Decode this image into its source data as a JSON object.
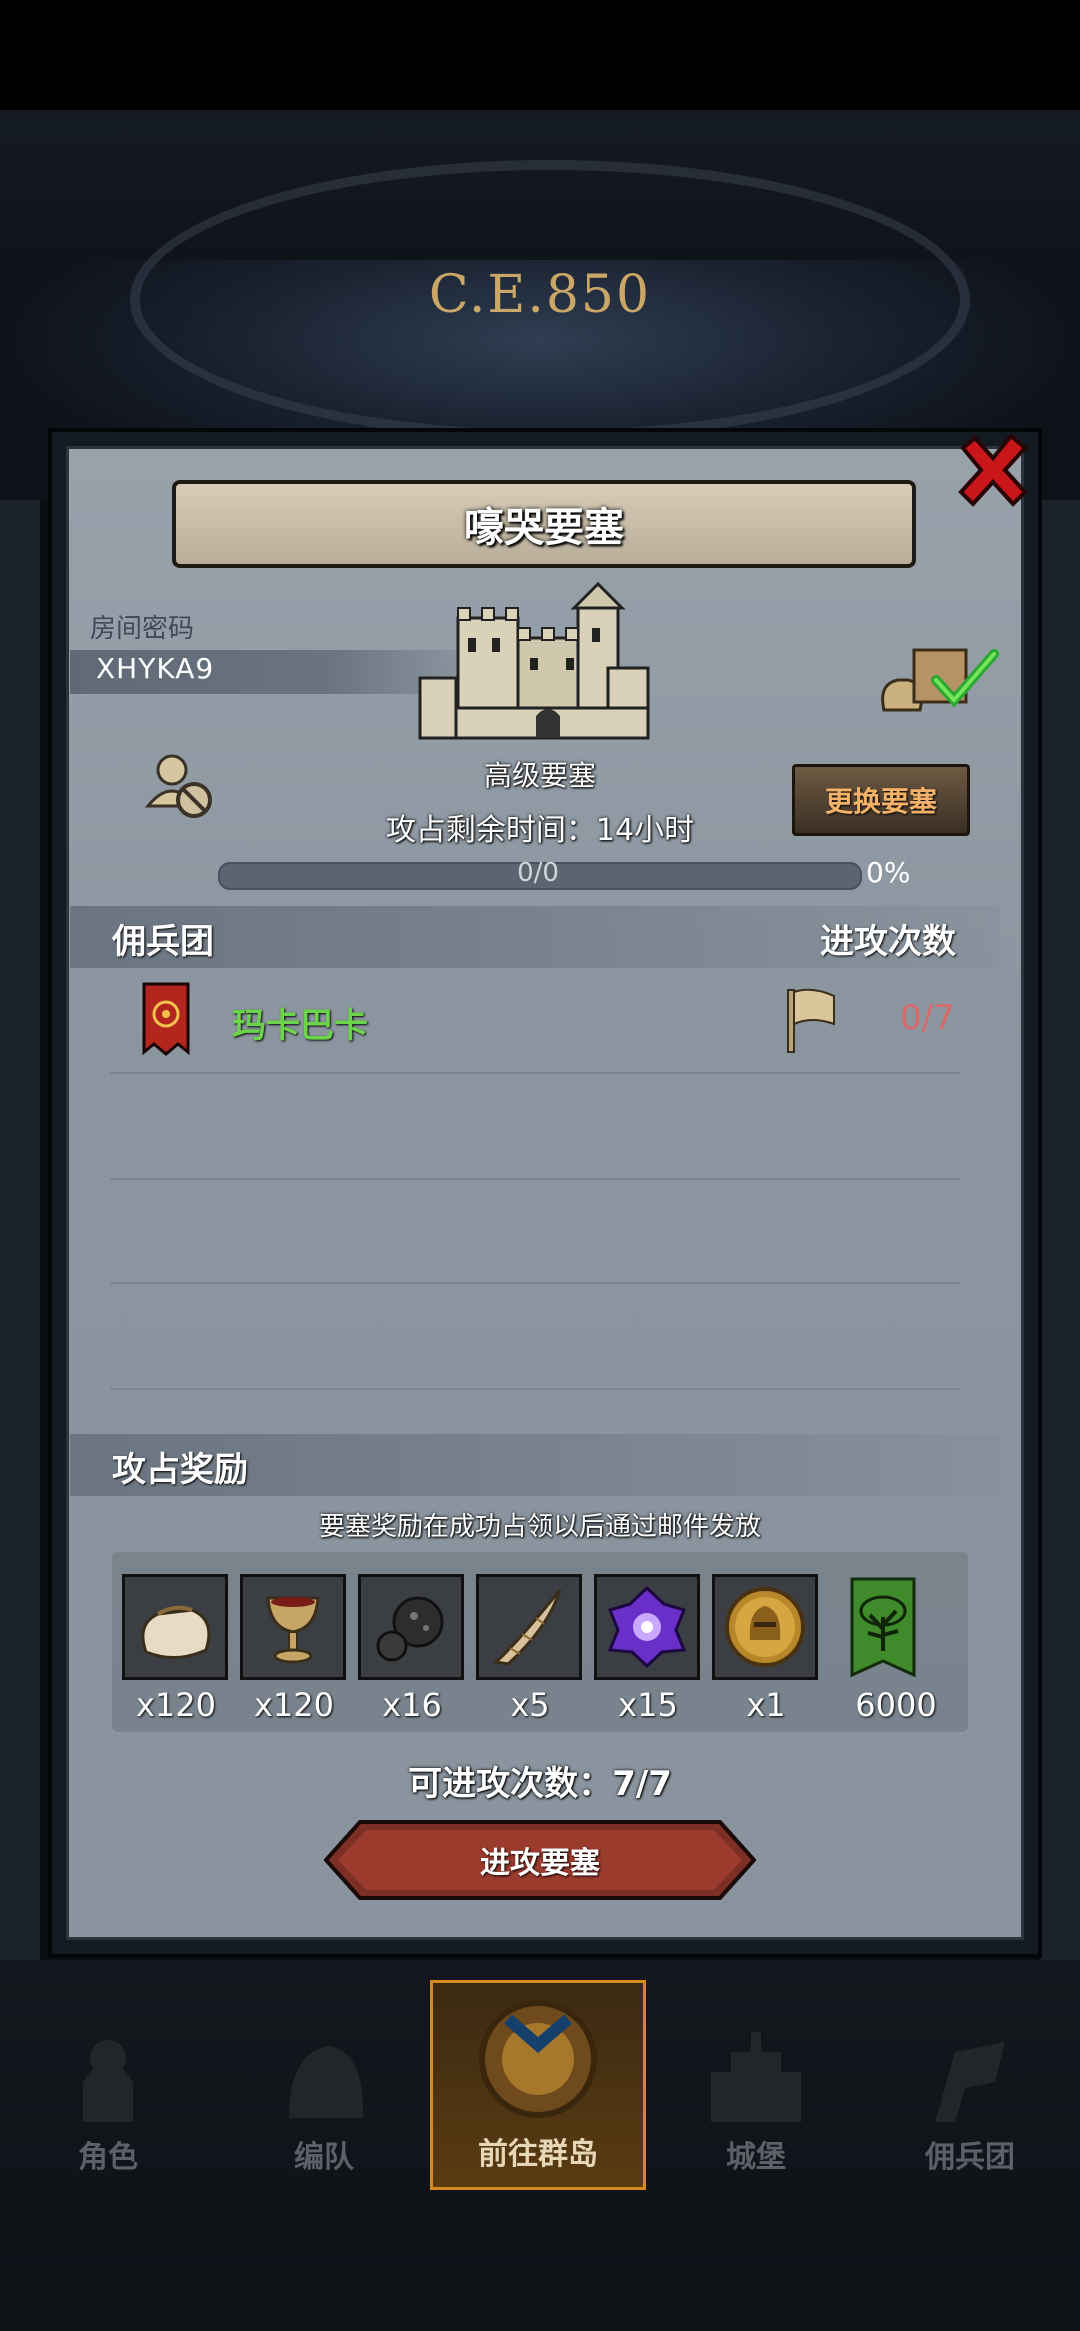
{
  "background": {
    "era_label": "C.E.850"
  },
  "dialog": {
    "title": "嚎哭要塞",
    "room": {
      "label": "房间密码",
      "code": "XHYKA9"
    },
    "fortress_level": "高级要塞",
    "time_left": "攻占剩余时间：14小时",
    "progress": {
      "text": "0/0",
      "percent_label": "0%",
      "fraction": 0
    },
    "change_button": "更换要塞",
    "mercenary_section": {
      "title": "佣兵团",
      "attack_header": "进攻次数",
      "rows": [
        {
          "name": "玛卡巴卡",
          "attacks": "0/7"
        }
      ]
    },
    "rewards": {
      "title": "攻占奖励",
      "note": "要塞奖励在成功占领以后通过邮件发放",
      "items": [
        {
          "icon": "sack-icon",
          "qty": "x120"
        },
        {
          "icon": "goblet-icon",
          "qty": "x120"
        },
        {
          "icon": "ore-icon",
          "qty": "x16"
        },
        {
          "icon": "horn-icon",
          "qty": "x5"
        },
        {
          "icon": "purple-crystal-icon",
          "qty": "x15"
        },
        {
          "icon": "knight-medal-icon",
          "qty": "x1"
        },
        {
          "icon": "tree-banner-icon",
          "qty": "6000"
        }
      ]
    },
    "attempts": "可进攻次数：7/7",
    "attack_button": "进攻要塞"
  },
  "nav": {
    "items": [
      {
        "label": "角色",
        "active": false
      },
      {
        "label": "编队",
        "active": false
      },
      {
        "label": "前往群岛",
        "active": true
      },
      {
        "label": "城堡",
        "active": false
      },
      {
        "label": "佣兵团",
        "active": false
      }
    ]
  },
  "colors": {
    "accent_green": "#6bd44a",
    "attack_count_red": "#d96a6a",
    "change_button_text": "#f3b268",
    "active_nav_border": "#d48a1e"
  }
}
